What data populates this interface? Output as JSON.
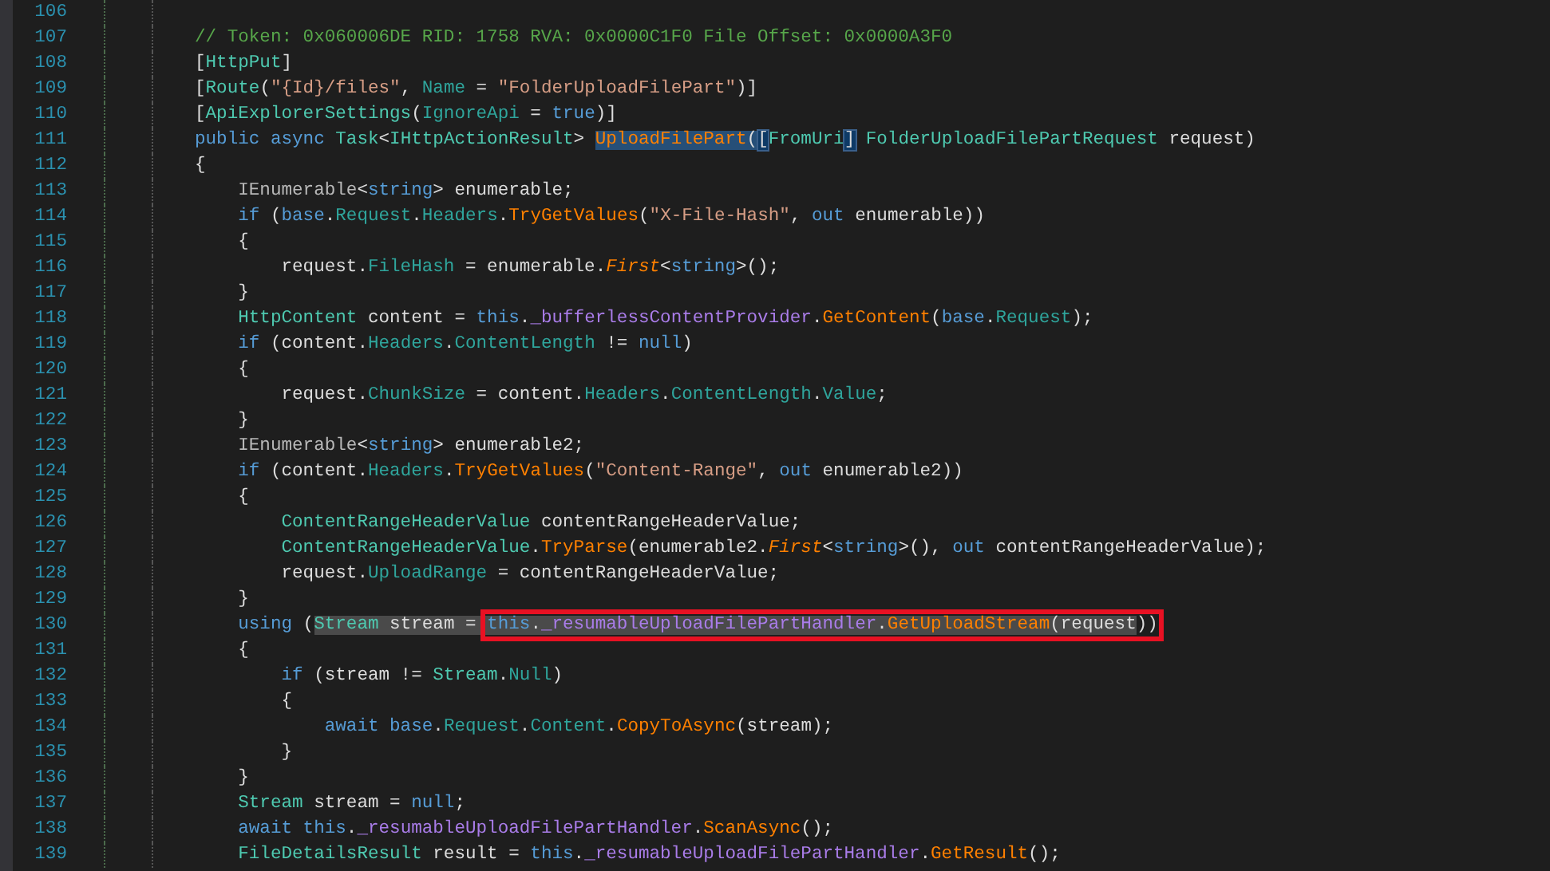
{
  "lines": [
    {
      "number": "106"
    },
    {
      "number": "107",
      "tokens": [
        {
          "text": "// Token: 0x060006DE RID: 1758 RVA: 0x0000C1F0 File Offset: 0x0000A3F0",
          "kind": "comment"
        }
      ]
    },
    {
      "number": "108",
      "tokens": [
        {
          "text": "[",
          "kind": "plain"
        },
        {
          "text": "HttpPut",
          "kind": "type"
        },
        {
          "text": "]",
          "kind": "plain"
        }
      ]
    },
    {
      "number": "109",
      "tokens": [
        {
          "text": "[",
          "kind": "plain"
        },
        {
          "text": "Route",
          "kind": "type"
        },
        {
          "text": "(",
          "kind": "plain"
        },
        {
          "text": "\"{Id}/files\"",
          "kind": "string"
        },
        {
          "text": ", ",
          "kind": "plain"
        },
        {
          "text": "Name",
          "kind": "property"
        },
        {
          "text": " = ",
          "kind": "plain"
        },
        {
          "text": "\"FolderUploadFilePart\"",
          "kind": "string"
        },
        {
          "text": ")]",
          "kind": "plain"
        }
      ]
    },
    {
      "number": "110",
      "tokens": [
        {
          "text": "[",
          "kind": "plain"
        },
        {
          "text": "ApiExplorerSettings",
          "kind": "type"
        },
        {
          "text": "(",
          "kind": "plain"
        },
        {
          "text": "IgnoreApi",
          "kind": "property"
        },
        {
          "text": " = ",
          "kind": "plain"
        },
        {
          "text": "true",
          "kind": "keyword"
        },
        {
          "text": ")]",
          "kind": "plain"
        }
      ]
    },
    {
      "number": "111",
      "tokens": [
        {
          "text": "public async ",
          "kind": "keyword"
        },
        {
          "text": "Task",
          "kind": "type"
        },
        {
          "text": "<",
          "kind": "plain"
        },
        {
          "text": "IHttpActionResult",
          "kind": "type"
        },
        {
          "text": "> ",
          "kind": "plain"
        },
        {
          "kind": "selection",
          "tokens": [
            {
              "text": "UploadFilePart",
              "kind": "method"
            },
            {
              "text": "(",
              "kind": "plain"
            }
          ]
        },
        {
          "kind": "bracket",
          "tokens": [
            {
              "text": "[",
              "kind": "plain"
            }
          ]
        },
        {
          "text": "FromUri",
          "kind": "type"
        },
        {
          "kind": "bracket",
          "tokens": [
            {
              "text": "]",
              "kind": "plain"
            }
          ]
        },
        {
          "text": " FolderUploadFilePartRequest",
          "kind": "type"
        },
        {
          "text": " request)",
          "kind": "plain"
        }
      ]
    },
    {
      "number": "112",
      "tokens": [
        {
          "text": "{",
          "kind": "plain"
        }
      ]
    },
    {
      "number": "113",
      "tokens": [
        {
          "text": "    IEnumerable",
          "kind": "interface"
        },
        {
          "text": "<",
          "kind": "plain"
        },
        {
          "text": "string",
          "kind": "keyword"
        },
        {
          "text": "> enumerable;",
          "kind": "plain"
        }
      ]
    },
    {
      "number": "114",
      "tokens": [
        {
          "text": "    if",
          "kind": "keyword"
        },
        {
          "text": " (",
          "kind": "plain"
        },
        {
          "text": "base",
          "kind": "keyword"
        },
        {
          "text": ".",
          "kind": "plain"
        },
        {
          "text": "Request",
          "kind": "property"
        },
        {
          "text": ".",
          "kind": "plain"
        },
        {
          "text": "Headers",
          "kind": "property"
        },
        {
          "text": ".",
          "kind": "plain"
        },
        {
          "text": "TryGetValues",
          "kind": "method"
        },
        {
          "text": "(",
          "kind": "plain"
        },
        {
          "text": "\"X-File-Hash\"",
          "kind": "string"
        },
        {
          "text": ", ",
          "kind": "plain"
        },
        {
          "text": "out",
          "kind": "keyword"
        },
        {
          "text": " enumerable))",
          "kind": "plain"
        }
      ]
    },
    {
      "number": "115",
      "tokens": [
        {
          "text": "    {",
          "kind": "plain"
        }
      ]
    },
    {
      "number": "116",
      "tokens": [
        {
          "text": "        request.",
          "kind": "plain"
        },
        {
          "text": "FileHash",
          "kind": "property"
        },
        {
          "text": " = enumerable.",
          "kind": "plain"
        },
        {
          "text": "First",
          "kind": "extension"
        },
        {
          "text": "<",
          "kind": "plain"
        },
        {
          "text": "string",
          "kind": "keyword"
        },
        {
          "text": ">();",
          "kind": "plain"
        }
      ]
    },
    {
      "number": "117",
      "tokens": [
        {
          "text": "    }",
          "kind": "plain"
        }
      ]
    },
    {
      "number": "118",
      "tokens": [
        {
          "text": "    HttpContent",
          "kind": "type"
        },
        {
          "text": " content = ",
          "kind": "plain"
        },
        {
          "text": "this",
          "kind": "keyword"
        },
        {
          "text": ".",
          "kind": "plain"
        },
        {
          "text": "_bufferlessContentProvider",
          "kind": "field"
        },
        {
          "text": ".",
          "kind": "plain"
        },
        {
          "text": "GetContent",
          "kind": "method"
        },
        {
          "text": "(",
          "kind": "plain"
        },
        {
          "text": "base",
          "kind": "keyword"
        },
        {
          "text": ".",
          "kind": "plain"
        },
        {
          "text": "Request",
          "kind": "property"
        },
        {
          "text": ");",
          "kind": "plain"
        }
      ]
    },
    {
      "number": "119",
      "tokens": [
        {
          "text": "    if",
          "kind": "keyword"
        },
        {
          "text": " (content.",
          "kind": "plain"
        },
        {
          "text": "Headers",
          "kind": "property"
        },
        {
          "text": ".",
          "kind": "plain"
        },
        {
          "text": "ContentLength",
          "kind": "property"
        },
        {
          "text": " != ",
          "kind": "plain"
        },
        {
          "text": "null",
          "kind": "keyword"
        },
        {
          "text": ")",
          "kind": "plain"
        }
      ]
    },
    {
      "number": "120",
      "tokens": [
        {
          "text": "    {",
          "kind": "plain"
        }
      ]
    },
    {
      "number": "121",
      "tokens": [
        {
          "text": "        request.",
          "kind": "plain"
        },
        {
          "text": "ChunkSize",
          "kind": "property"
        },
        {
          "text": " = content.",
          "kind": "plain"
        },
        {
          "text": "Headers",
          "kind": "property"
        },
        {
          "text": ".",
          "kind": "plain"
        },
        {
          "text": "ContentLength",
          "kind": "property"
        },
        {
          "text": ".",
          "kind": "plain"
        },
        {
          "text": "Value",
          "kind": "property"
        },
        {
          "text": ";",
          "kind": "plain"
        }
      ]
    },
    {
      "number": "122",
      "tokens": [
        {
          "text": "    }",
          "kind": "plain"
        }
      ]
    },
    {
      "number": "123",
      "tokens": [
        {
          "text": "    IEnumerable",
          "kind": "interface"
        },
        {
          "text": "<",
          "kind": "plain"
        },
        {
          "text": "string",
          "kind": "keyword"
        },
        {
          "text": "> enumerable2;",
          "kind": "plain"
        }
      ]
    },
    {
      "number": "124",
      "tokens": [
        {
          "text": "    if",
          "kind": "keyword"
        },
        {
          "text": " (content.",
          "kind": "plain"
        },
        {
          "text": "Headers",
          "kind": "property"
        },
        {
          "text": ".",
          "kind": "plain"
        },
        {
          "text": "TryGetValues",
          "kind": "method"
        },
        {
          "text": "(",
          "kind": "plain"
        },
        {
          "text": "\"Content-Range\"",
          "kind": "string"
        },
        {
          "text": ", ",
          "kind": "plain"
        },
        {
          "text": "out",
          "kind": "keyword"
        },
        {
          "text": " enumerable2))",
          "kind": "plain"
        }
      ]
    },
    {
      "number": "125",
      "tokens": [
        {
          "text": "    {",
          "kind": "plain"
        }
      ]
    },
    {
      "number": "126",
      "tokens": [
        {
          "text": "        ContentRangeHeaderValue",
          "kind": "type"
        },
        {
          "text": " contentRangeHeaderValue;",
          "kind": "plain"
        }
      ]
    },
    {
      "number": "127",
      "tokens": [
        {
          "text": "        ContentRangeHeaderValue",
          "kind": "type"
        },
        {
          "text": ".",
          "kind": "plain"
        },
        {
          "text": "TryParse",
          "kind": "method"
        },
        {
          "text": "(enumerable2.",
          "kind": "plain"
        },
        {
          "text": "First",
          "kind": "extension"
        },
        {
          "text": "<",
          "kind": "plain"
        },
        {
          "text": "string",
          "kind": "keyword"
        },
        {
          "text": ">(), ",
          "kind": "plain"
        },
        {
          "text": "out",
          "kind": "keyword"
        },
        {
          "text": " contentRangeHeaderValue);",
          "kind": "plain"
        }
      ]
    },
    {
      "number": "128",
      "tokens": [
        {
          "text": "        request.",
          "kind": "plain"
        },
        {
          "text": "UploadRange",
          "kind": "property"
        },
        {
          "text": " = contentRangeHeaderValue;",
          "kind": "plain"
        }
      ]
    },
    {
      "number": "129",
      "tokens": [
        {
          "text": "    }",
          "kind": "plain"
        }
      ]
    },
    {
      "number": "130",
      "tokens": [
        {
          "text": "    using",
          "kind": "keyword"
        },
        {
          "text": " (",
          "kind": "plain"
        },
        {
          "kind": "reference",
          "tokens": [
            {
              "text": "Stream",
              "kind": "type"
            },
            {
              "text": " stream = ",
              "kind": "plain"
            }
          ]
        },
        {
          "kind": "annotation",
          "tokens": [
            {
              "kind": "reference",
              "tokens": [
                {
                  "text": "this",
                  "kind": "keyword"
                },
                {
                  "text": ".",
                  "kind": "plain"
                },
                {
                  "text": "_resumableUploadFilePartHandler",
                  "kind": "field"
                },
                {
                  "text": ".",
                  "kind": "plain"
                },
                {
                  "text": "GetUploadStream",
                  "kind": "method"
                },
                {
                  "text": "(request",
                  "kind": "plain"
                }
              ]
            },
            {
              "text": "))",
              "kind": "plain"
            }
          ]
        }
      ]
    },
    {
      "number": "131",
      "tokens": [
        {
          "text": "    {",
          "kind": "plain"
        }
      ]
    },
    {
      "number": "132",
      "tokens": [
        {
          "text": "        if",
          "kind": "keyword"
        },
        {
          "text": " (stream != ",
          "kind": "plain"
        },
        {
          "text": "Stream",
          "kind": "type"
        },
        {
          "text": ".",
          "kind": "plain"
        },
        {
          "text": "Null",
          "kind": "property"
        },
        {
          "text": ")",
          "kind": "plain"
        }
      ]
    },
    {
      "number": "133",
      "tokens": [
        {
          "text": "        {",
          "kind": "plain"
        }
      ]
    },
    {
      "number": "134",
      "tokens": [
        {
          "text": "            await base",
          "kind": "keyword"
        },
        {
          "text": ".",
          "kind": "plain"
        },
        {
          "text": "Request",
          "kind": "property"
        },
        {
          "text": ".",
          "kind": "plain"
        },
        {
          "text": "Content",
          "kind": "property"
        },
        {
          "text": ".",
          "kind": "plain"
        },
        {
          "text": "CopyToAsync",
          "kind": "method"
        },
        {
          "text": "(stream);",
          "kind": "plain"
        }
      ]
    },
    {
      "number": "135",
      "tokens": [
        {
          "text": "        }",
          "kind": "plain"
        }
      ]
    },
    {
      "number": "136",
      "tokens": [
        {
          "text": "    }",
          "kind": "plain"
        }
      ]
    },
    {
      "number": "137",
      "tokens": [
        {
          "text": "    Stream",
          "kind": "type"
        },
        {
          "text": " stream = ",
          "kind": "plain"
        },
        {
          "text": "null",
          "kind": "keyword"
        },
        {
          "text": ";",
          "kind": "plain"
        }
      ]
    },
    {
      "number": "138",
      "tokens": [
        {
          "text": "    await this",
          "kind": "keyword"
        },
        {
          "text": ".",
          "kind": "plain"
        },
        {
          "text": "_resumableUploadFilePartHandler",
          "kind": "field"
        },
        {
          "text": ".",
          "kind": "plain"
        },
        {
          "text": "ScanAsync",
          "kind": "method"
        },
        {
          "text": "();",
          "kind": "plain"
        }
      ]
    },
    {
      "number": "139",
      "tokens": [
        {
          "text": "    FileDetailsResult",
          "kind": "type"
        },
        {
          "text": " result = ",
          "kind": "plain"
        },
        {
          "text": "this",
          "kind": "keyword"
        },
        {
          "text": ".",
          "kind": "plain"
        },
        {
          "text": "_resumableUploadFilePartHandler",
          "kind": "field"
        },
        {
          "text": ".",
          "kind": "plain"
        },
        {
          "text": "GetResult",
          "kind": "method"
        },
        {
          "text": "();",
          "kind": "plain"
        }
      ]
    }
  ]
}
